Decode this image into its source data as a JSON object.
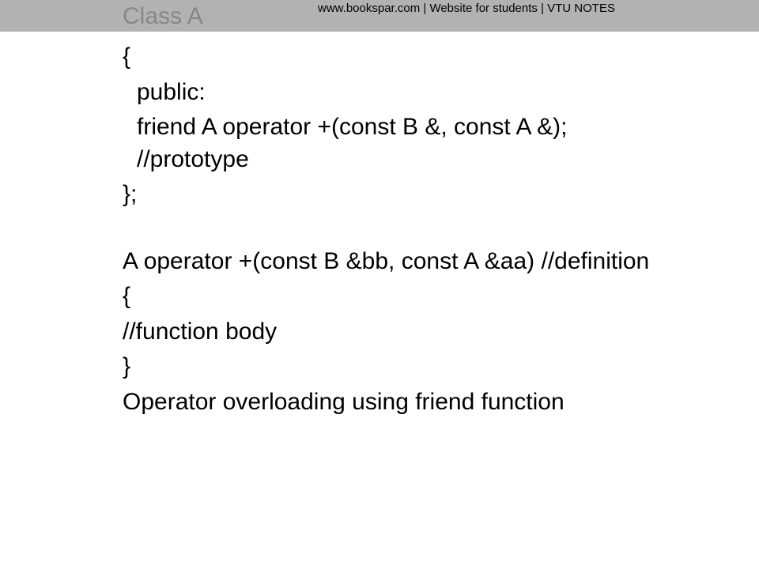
{
  "header": {
    "site_text": "www.bookspar.com | Website for students | VTU NOTES"
  },
  "title": "Class A",
  "lines": {
    "l1": "{",
    "l2": " public:",
    "l3": " friend A operator +(const B &, const A &); //prototype",
    "l4": "};",
    "l5": "A operator +(const B &bb, const A &aa)      //definition",
    "l6": "{",
    "l7": "//function body",
    "l8": "}",
    "l9": "Operator overloading using friend function"
  }
}
